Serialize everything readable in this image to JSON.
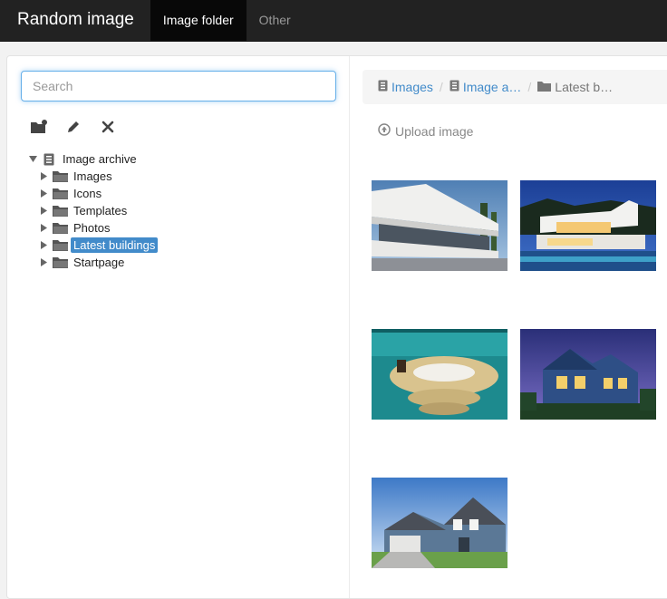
{
  "navbar": {
    "brand": "Random image",
    "links": [
      {
        "label": "Image folder",
        "active": true
      },
      {
        "label": "Other",
        "active": false
      }
    ]
  },
  "sidebar": {
    "search": {
      "value": "",
      "placeholder": "Search"
    },
    "toolbar": {
      "add_folder_icon": "folder-plus-icon",
      "edit_icon": "pencil-icon",
      "delete_icon": "close-icon"
    },
    "tree": {
      "root": {
        "label": "Image archive",
        "expanded": true
      },
      "children": [
        {
          "label": "Images",
          "selected": false
        },
        {
          "label": "Icons",
          "selected": false
        },
        {
          "label": "Templates",
          "selected": false
        },
        {
          "label": "Photos",
          "selected": false
        },
        {
          "label": "Latest buildings",
          "selected": true
        },
        {
          "label": "Startpage",
          "selected": false
        }
      ]
    }
  },
  "main": {
    "breadcrumb": [
      {
        "label": "Images",
        "icon": "archive-icon",
        "link": true
      },
      {
        "label": "Image a…",
        "icon": "archive-icon",
        "link": true
      },
      {
        "label": "Latest b…",
        "icon": "folder-icon",
        "link": false
      }
    ],
    "upload_label": "Upload image",
    "images": [
      {
        "subject": "modern white villa"
      },
      {
        "subject": "modern house at night"
      },
      {
        "subject": "indoor pool bedroom"
      },
      {
        "subject": "house at dusk"
      },
      {
        "subject": "blue suburban house"
      }
    ]
  },
  "colors": {
    "navbar": "#222222",
    "accent": "#428bca",
    "selected_bg": "#428bca",
    "focus": "#66afe9"
  }
}
